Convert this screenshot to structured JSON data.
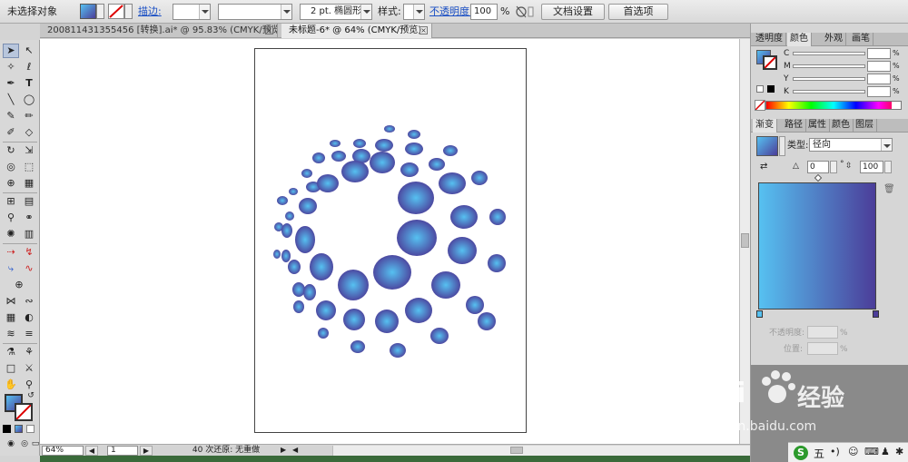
{
  "control_bar": {
    "selection_label": "未选择对象",
    "stroke_label": "描边:",
    "brush_value": "2 pt. 椭圆形",
    "style_label": "样式:",
    "opacity_label": "不透明度:",
    "opacity_value": "100",
    "opacity_unit": "%",
    "doc_setup_button": "文档设置",
    "preferences_button": "首选项"
  },
  "tabs": [
    {
      "label": "200811431355456 [转换].ai* @ 95.83% (CMYK/预览)"
    },
    {
      "label": "未标题-6* @ 64% (CMYK/预览)"
    }
  ],
  "toolbox": {
    "tools": [
      "selection-tool",
      "direct-selection-tool",
      "magic-wand-tool",
      "lasso-tool",
      "pen-tool",
      "type-tool",
      "line-tool",
      "ellipse-tool",
      "paintbrush-tool",
      "pencil-tool",
      "blob-brush-tool",
      "eraser-tool",
      "rotate-tool",
      "scale-tool",
      "warp-tool",
      "free-transform-tool",
      "shape-builder-tool",
      "perspective-tool",
      "mesh-tool",
      "gradient-tool",
      "eyedropper-tool",
      "blend-tool",
      "symbol-sprayer-tool",
      "column-graph-tool",
      "artboard-tool",
      "slice-tool",
      "hand-tool",
      "zoom-tool"
    ]
  },
  "statusbar": {
    "zoom_value": "64%",
    "page_value": "1",
    "undo_text": "40 次还原: 无重做"
  },
  "color_panel": {
    "tabs": [
      "透明度",
      "颜色",
      "外观",
      "画笔"
    ],
    "active_tab": "颜色",
    "channels": [
      {
        "name": "C",
        "value": ""
      },
      {
        "name": "M",
        "value": ""
      },
      {
        "name": "Y",
        "value": ""
      },
      {
        "name": "K",
        "value": ""
      }
    ],
    "percent": "%"
  },
  "gradient_panel": {
    "tabs": [
      "渐变",
      "路径",
      "属性",
      "颜色",
      "图层"
    ],
    "active_tab": "渐变",
    "type_label": "类型:",
    "type_value": "径向",
    "angle_value": "0",
    "degree": "°",
    "ratio_value": "100",
    "opacity_label": "不透明度:",
    "position_label": "位置:",
    "percent": "%"
  },
  "colors": {
    "gradient_start": "#56c1f1",
    "gradient_end": "#4b3d99"
  },
  "watermark": {
    "text": "Bai",
    "text_cn": "经验",
    "url": "jingyan.baidu.com"
  },
  "taskbar": {
    "ime": "五"
  }
}
